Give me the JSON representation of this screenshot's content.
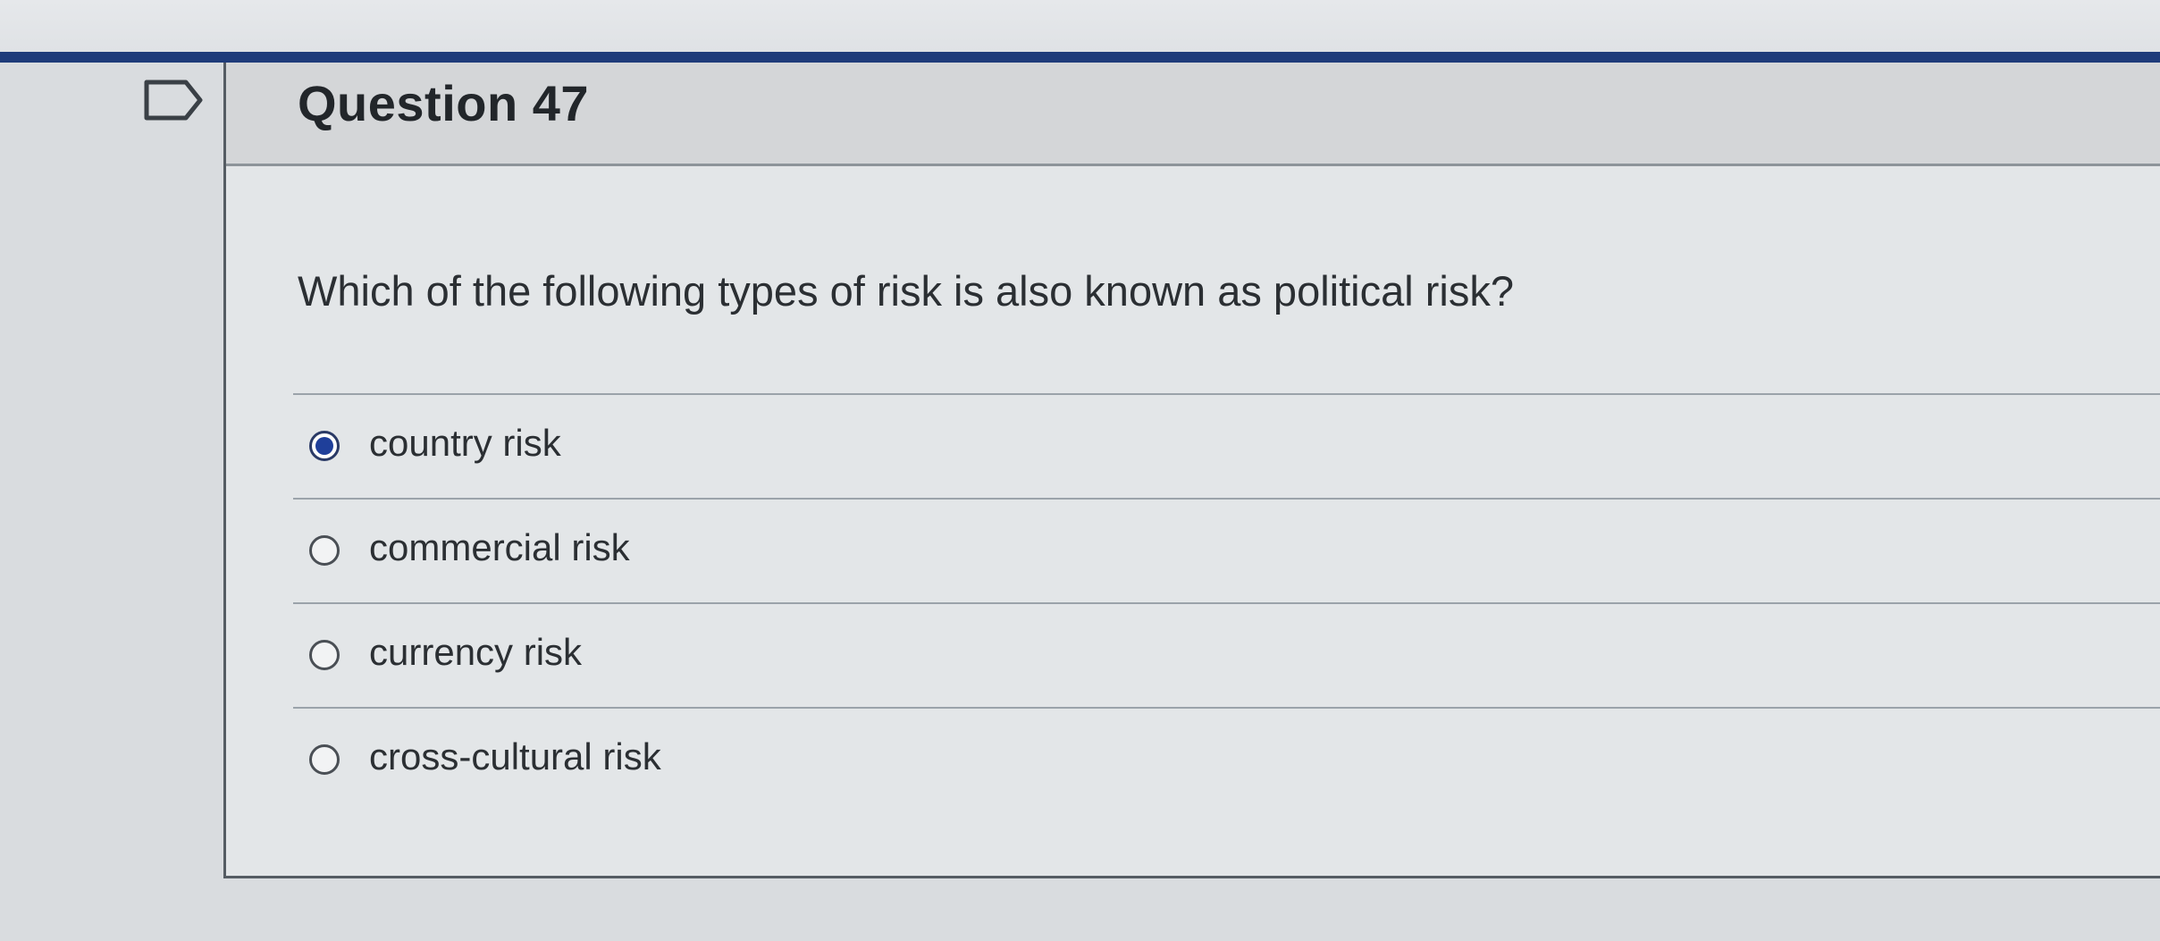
{
  "question": {
    "title": "Question 47",
    "text": "Which of the following types of risk is also known as political risk?"
  },
  "answers": [
    {
      "label": "country risk",
      "selected": true
    },
    {
      "label": "commercial risk",
      "selected": false
    },
    {
      "label": "currency risk",
      "selected": false
    },
    {
      "label": "cross-cultural risk",
      "selected": false
    }
  ],
  "icons": {
    "bookmark": "bookmark-flag-icon"
  },
  "colors": {
    "top_bar": "#1f3c7a",
    "selected_radio": "#1f3f9a"
  }
}
